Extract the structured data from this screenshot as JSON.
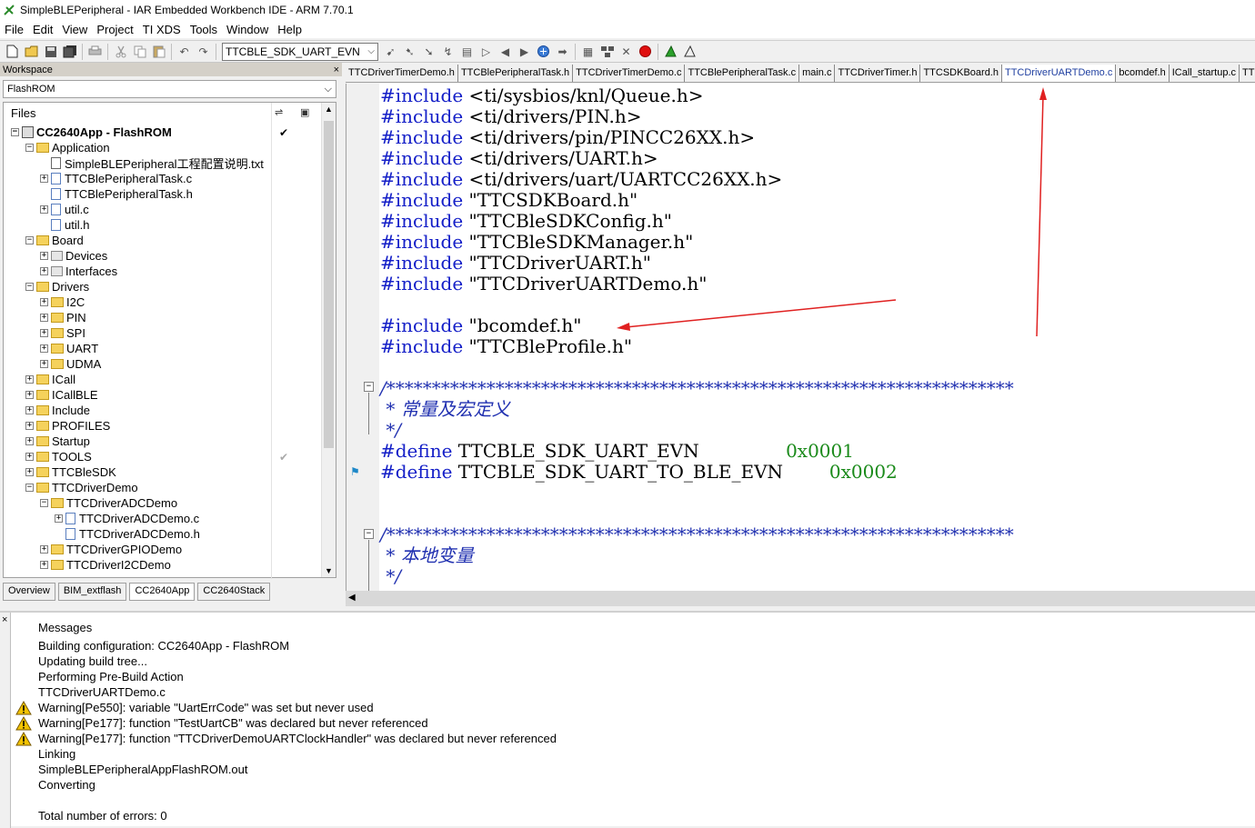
{
  "window": {
    "title": "SimpleBLEPeripheral - IAR Embedded Workbench IDE - ARM 7.70.1"
  },
  "menu": [
    "File",
    "Edit",
    "View",
    "Project",
    "TI XDS",
    "Tools",
    "Window",
    "Help"
  ],
  "toolbar": {
    "search_combo_value": "TTCBLE_SDK_UART_EVN"
  },
  "workspace": {
    "header": "Workspace",
    "close": "×",
    "config": "FlashROM",
    "files_header": "Files",
    "tabs": [
      "Overview",
      "BIM_extflash",
      "CC2640App",
      "CC2640Stack"
    ]
  },
  "tree": [
    {
      "label": "CC2640App - FlashROM",
      "depth": 0,
      "exp": "−",
      "icon": "project-icon",
      "check": "✔",
      "bold": true
    },
    {
      "label": "Application",
      "depth": 1,
      "exp": "−",
      "icon": "folder-icon"
    },
    {
      "label": "SimpleBLEPeripheral工程配置说明.txt",
      "depth": 2,
      "exp": "",
      "icon": "text-file-icon"
    },
    {
      "label": "TTCBlePeripheralTask.c",
      "depth": 2,
      "exp": "+",
      "icon": "c-file-icon"
    },
    {
      "label": "TTCBlePeripheralTask.h",
      "depth": 2,
      "exp": "",
      "icon": "h-file-icon"
    },
    {
      "label": "util.c",
      "depth": 2,
      "exp": "+",
      "icon": "c-file-icon"
    },
    {
      "label": "util.h",
      "depth": 2,
      "exp": "",
      "icon": "h-file-icon"
    },
    {
      "label": "Board",
      "depth": 1,
      "exp": "−",
      "icon": "folder-icon"
    },
    {
      "label": "Devices",
      "depth": 2,
      "exp": "+",
      "icon": "group-icon"
    },
    {
      "label": "Interfaces",
      "depth": 2,
      "exp": "+",
      "icon": "group-icon"
    },
    {
      "label": "Drivers",
      "depth": 1,
      "exp": "−",
      "icon": "folder-icon"
    },
    {
      "label": "I2C",
      "depth": 2,
      "exp": "+",
      "icon": "folder-icon"
    },
    {
      "label": "PIN",
      "depth": 2,
      "exp": "+",
      "icon": "folder-icon"
    },
    {
      "label": "SPI",
      "depth": 2,
      "exp": "+",
      "icon": "folder-icon"
    },
    {
      "label": "UART",
      "depth": 2,
      "exp": "+",
      "icon": "folder-icon"
    },
    {
      "label": "UDMA",
      "depth": 2,
      "exp": "+",
      "icon": "folder-icon"
    },
    {
      "label": "ICall",
      "depth": 1,
      "exp": "+",
      "icon": "folder-icon"
    },
    {
      "label": "ICallBLE",
      "depth": 1,
      "exp": "+",
      "icon": "folder-icon"
    },
    {
      "label": "Include",
      "depth": 1,
      "exp": "+",
      "icon": "folder-icon"
    },
    {
      "label": "PROFILES",
      "depth": 1,
      "exp": "+",
      "icon": "folder-icon"
    },
    {
      "label": "Startup",
      "depth": 1,
      "exp": "+",
      "icon": "folder-icon"
    },
    {
      "label": "TOOLS",
      "depth": 1,
      "exp": "+",
      "icon": "folder-icon",
      "check": "✔",
      "checkGray": true
    },
    {
      "label": "TTCBleSDK",
      "depth": 1,
      "exp": "+",
      "icon": "folder-icon"
    },
    {
      "label": "TTCDriverDemo",
      "depth": 1,
      "exp": "−",
      "icon": "folder-icon"
    },
    {
      "label": "TTCDriverADCDemo",
      "depth": 2,
      "exp": "−",
      "icon": "folder-icon"
    },
    {
      "label": "TTCDriverADCDemo.c",
      "depth": 3,
      "exp": "+",
      "icon": "c-file-icon"
    },
    {
      "label": "TTCDriverADCDemo.h",
      "depth": 3,
      "exp": "",
      "icon": "h-file-icon"
    },
    {
      "label": "TTCDriverGPIODemo",
      "depth": 2,
      "exp": "+",
      "icon": "folder-icon"
    },
    {
      "label": "TTCDriverI2CDemo",
      "depth": 2,
      "exp": "+",
      "icon": "folder-icon"
    }
  ],
  "editor_tabs": [
    {
      "label": "TTCDriverTimerDemo.h",
      "active": false
    },
    {
      "label": "TTCBlePeripheralTask.h",
      "active": false
    },
    {
      "label": "TTCDriverTimerDemo.c",
      "active": false
    },
    {
      "label": "TTCBlePeripheralTask.c",
      "active": false
    },
    {
      "label": "main.c",
      "active": false
    },
    {
      "label": "TTCDriverTimer.h",
      "active": false
    },
    {
      "label": "TTCSDKBoard.h",
      "active": false
    },
    {
      "label": "TTCDriverUARTDemo.c",
      "active": true
    },
    {
      "label": "bcomdef.h",
      "active": false
    },
    {
      "label": "ICall_startup.c",
      "active": false
    },
    {
      "label": "TTCD",
      "active": false
    }
  ],
  "code": [
    [
      {
        "t": "#include",
        "c": "kw"
      },
      {
        "t": " <ti/sysbios/knl/Queue.h>",
        "c": "str"
      }
    ],
    [
      {
        "t": "#include",
        "c": "kw"
      },
      {
        "t": " <ti/drivers/PIN.h>",
        "c": "str"
      }
    ],
    [
      {
        "t": "#include",
        "c": "kw"
      },
      {
        "t": " <ti/drivers/pin/PINCC26XX.h>",
        "c": "str"
      }
    ],
    [
      {
        "t": "#include",
        "c": "kw"
      },
      {
        "t": " <ti/drivers/UART.h>",
        "c": "str"
      }
    ],
    [
      {
        "t": "#include",
        "c": "kw"
      },
      {
        "t": " <ti/drivers/uart/UARTCC26XX.h>",
        "c": "str"
      }
    ],
    [
      {
        "t": "#include",
        "c": "kw"
      },
      {
        "t": " \"TTCSDKBoard.h\"",
        "c": "str"
      }
    ],
    [
      {
        "t": "#include",
        "c": "kw"
      },
      {
        "t": " \"TTCBleSDKConfig.h\"",
        "c": "str"
      }
    ],
    [
      {
        "t": "#include",
        "c": "kw"
      },
      {
        "t": " \"TTCBleSDKManager.h\"",
        "c": "str"
      }
    ],
    [
      {
        "t": "#include",
        "c": "kw"
      },
      {
        "t": " \"TTCDriverUART.h\"",
        "c": "str"
      }
    ],
    [
      {
        "t": "#include",
        "c": "kw"
      },
      {
        "t": " \"TTCDriverUARTDemo.h\"",
        "c": "str"
      }
    ],
    [],
    [
      {
        "t": "#include",
        "c": "kw"
      },
      {
        "t": " \"bcomdef.h\"",
        "c": "str"
      }
    ],
    [
      {
        "t": "#include",
        "c": "kw"
      },
      {
        "t": " \"TTCBleProfile.h\"",
        "c": "str"
      }
    ],
    [],
    [
      {
        "t": "/*********************************************************************",
        "c": "cmt"
      }
    ],
    [
      {
        "t": " * 常量及宏定义",
        "c": "cmt"
      }
    ],
    [
      {
        "t": " */",
        "c": "cmt"
      }
    ],
    [
      {
        "t": "#define",
        "c": "kw"
      },
      {
        "t": " TTCBLE_SDK_UART_EVN               ",
        "c": "str"
      },
      {
        "t": "0x0001",
        "c": "num"
      }
    ],
    [
      {
        "t": "#define",
        "c": "kw"
      },
      {
        "t": " TTCBLE_SDK_UART_TO_BLE_EVN        ",
        "c": "str"
      },
      {
        "t": "0x0002",
        "c": "num"
      }
    ],
    [],
    [],
    [
      {
        "t": "/*********************************************************************",
        "c": "cmt"
      }
    ],
    [
      {
        "t": " * 本地变量",
        "c": "cmt"
      }
    ],
    [
      {
        "t": " */",
        "c": "cmt"
      }
    ]
  ],
  "messages": {
    "header": "Messages",
    "lines": [
      {
        "text": "Building configuration: CC2640App - FlashROM",
        "warn": false
      },
      {
        "text": "Updating build tree...",
        "warn": false
      },
      {
        "text": "Performing Pre-Build Action",
        "warn": false
      },
      {
        "text": "TTCDriverUARTDemo.c",
        "warn": false
      },
      {
        "text": "Warning[Pe550]: variable \"UartErrCode\" was set but never used",
        "warn": true
      },
      {
        "text": "Warning[Pe177]: function \"TestUartCB\" was declared but never referenced",
        "warn": true
      },
      {
        "text": "Warning[Pe177]: function \"TTCDriverDemoUARTClockHandler\" was declared but never referenced",
        "warn": true
      },
      {
        "text": "Linking",
        "warn": false
      },
      {
        "text": "SimpleBLEPeripheralAppFlashROM.out",
        "warn": false
      },
      {
        "text": "Converting",
        "warn": false
      },
      {
        "text": "",
        "warn": false
      },
      {
        "text": "Total number of errors: 0",
        "warn": false
      }
    ]
  },
  "colors": {
    "keyword": "#1520c8",
    "comment": "#2030b0",
    "number": "#1a8a1a",
    "annotation_arrow": "#e02020",
    "warning": "#f3c300"
  }
}
